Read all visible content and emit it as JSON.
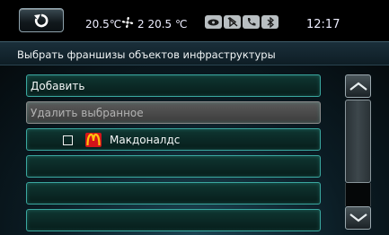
{
  "status": {
    "temp_left": "20.5℃",
    "fan_level": "2",
    "temp_right": "20.5 ℃",
    "time": "12:17",
    "icons": [
      "eye-icon",
      "media-mute-icon",
      "phone-icon",
      "bluetooth-icon"
    ]
  },
  "screen": {
    "title": "Выбрать франшизы объектов инфраструктуры"
  },
  "list": {
    "add_label": "Добавить",
    "delete_label": "Удалить выбранное",
    "items": [
      {
        "name": "Макдоналдс",
        "checked": false,
        "icon": "mcdonalds-logo-icon"
      }
    ]
  },
  "colors": {
    "row_border": "#3aa8a0",
    "disabled_row": "#4a4a4a",
    "mcdonalds_red": "#d4141a",
    "mcdonalds_yellow": "#ffc20e"
  }
}
